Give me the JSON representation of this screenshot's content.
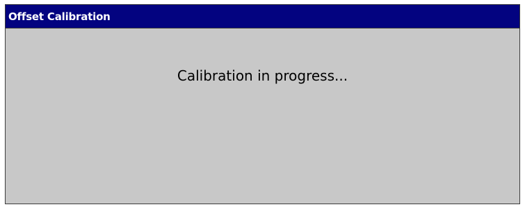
{
  "window": {
    "title": "Offset Calibration",
    "title_bar_color": "#030380",
    "background_color": "#c8c8c8"
  },
  "content": {
    "message": "Calibration in progress..."
  }
}
